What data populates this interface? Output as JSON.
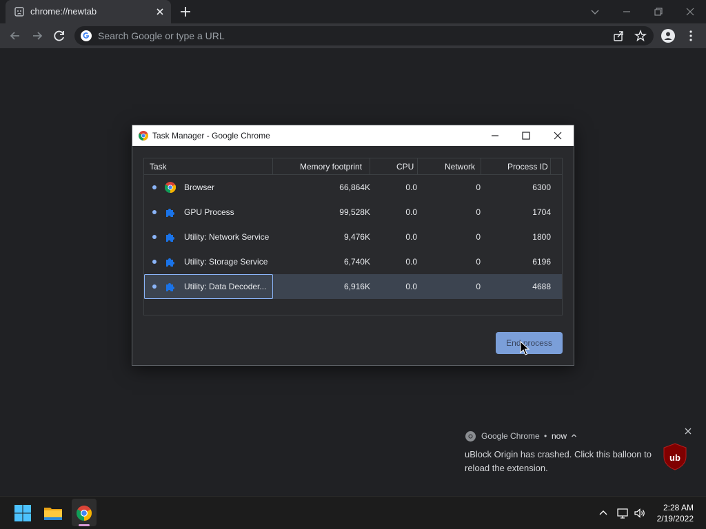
{
  "browser": {
    "tab_title": "chrome://newtab",
    "omnibox_placeholder": "Search Google or type a URL"
  },
  "task_manager": {
    "window_title": "Task Manager - Google Chrome",
    "columns": [
      "Task",
      "Memory footprint",
      "CPU",
      "Network",
      "Process ID"
    ],
    "rows": [
      {
        "name": "Browser",
        "icon": "chrome-icon",
        "memory": "66,864K",
        "cpu": "0.0",
        "network": "0",
        "pid": "6300",
        "selected": false
      },
      {
        "name": "GPU Process",
        "icon": "puzzle-icon",
        "memory": "99,528K",
        "cpu": "0.0",
        "network": "0",
        "pid": "1704",
        "selected": false
      },
      {
        "name": "Utility: Network Service",
        "icon": "puzzle-icon",
        "memory": "9,476K",
        "cpu": "0.0",
        "network": "0",
        "pid": "1800",
        "selected": false
      },
      {
        "name": "Utility: Storage Service",
        "icon": "puzzle-icon",
        "memory": "6,740K",
        "cpu": "0.0",
        "network": "0",
        "pid": "6196",
        "selected": false
      },
      {
        "name": "Utility: Data Decoder...",
        "icon": "puzzle-icon",
        "memory": "6,916K",
        "cpu": "0.0",
        "network": "0",
        "pid": "4688",
        "selected": true
      }
    ],
    "end_process_label": "End process"
  },
  "notification": {
    "app_name": "Google Chrome",
    "separator": "•",
    "time": "now",
    "message": "uBlock Origin has crashed. Click this balloon to reload the extension.",
    "logo_icon": "ublock-origin-icon"
  },
  "taskbar": {
    "clock_time": "2:28 AM",
    "clock_date": "2/19/2022",
    "apps": [
      "windows-start-icon",
      "file-explorer-icon",
      "chrome-icon"
    ]
  },
  "colors": {
    "accent": "#8ab4f8",
    "window_bg": "#202124",
    "toolbar_bg": "#35363a",
    "dialog_bg": "#292a2d",
    "selection": "#3c4450"
  }
}
